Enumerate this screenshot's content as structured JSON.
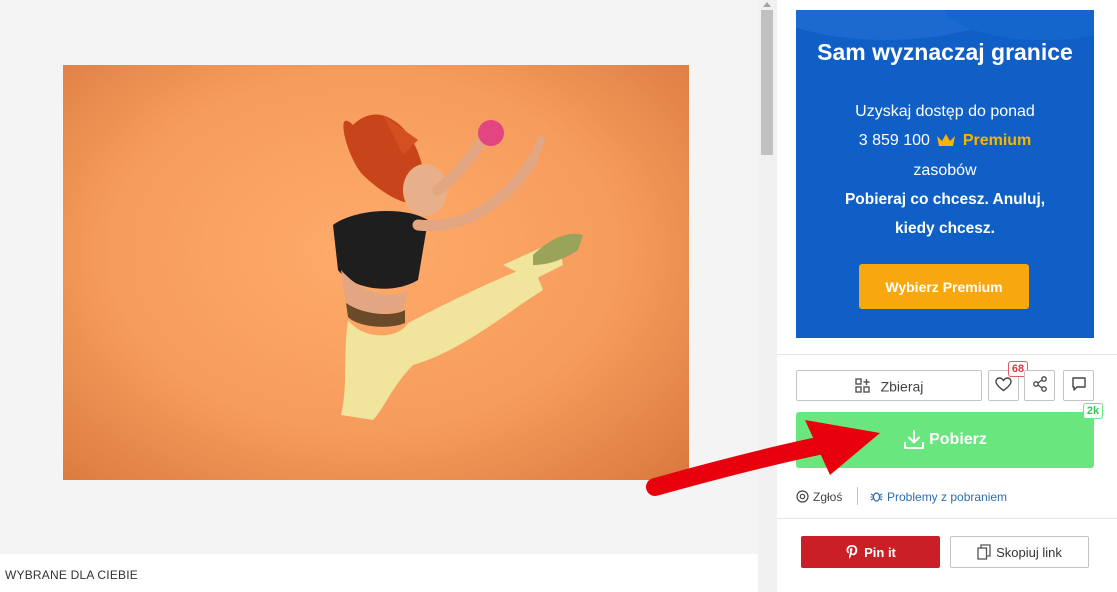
{
  "recommended": {
    "label": "WYBRANE DLA CIEBIE"
  },
  "promo": {
    "title": "Sam wyznaczaj granice",
    "line1": "Uzyskaj dostęp do ponad",
    "count": "3 859 100",
    "premium_word": "Premium",
    "line3": "zasobów",
    "bold1": "Pobieraj co chcesz. Anuluj,",
    "bold2": "kiedy chcesz.",
    "button": "Wybierz Premium"
  },
  "actions": {
    "collect_label": "Zbieraj",
    "likes_count": "68",
    "download_label": "Pobierz",
    "downloads_count": "2k",
    "report_label": "Zgłoś",
    "problems_label": "Problemy z pobraniem",
    "pin_label": "Pin it",
    "copy_label": "Skopiuj link"
  },
  "colors": {
    "promo_bg": "#0f5fc6",
    "premium_accent": "#f8b400",
    "download_green": "#6ae67f",
    "pinterest_red": "#cb1f27",
    "annotation_arrow": "#e8000d"
  },
  "icons": [
    "collect-icon",
    "heart-icon",
    "share-icon",
    "comment-icon",
    "download-icon",
    "report-icon",
    "bug-icon",
    "pinterest-icon",
    "copy-icon",
    "crown-icon"
  ]
}
